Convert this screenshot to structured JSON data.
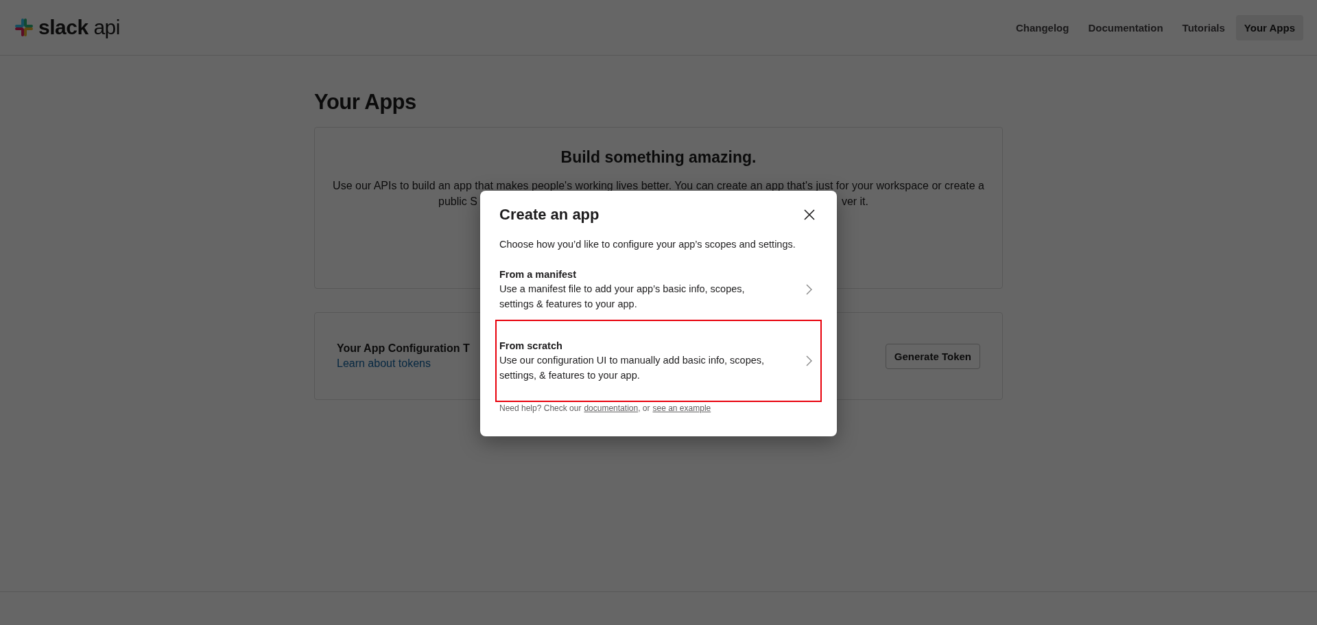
{
  "header": {
    "logo_text": "**slack** api",
    "nav": [
      {
        "label": "Changelog",
        "selected": false
      },
      {
        "label": "Documentation",
        "selected": false
      },
      {
        "label": "Tutorials",
        "selected": false
      },
      {
        "label": "Your Apps",
        "selected": true
      }
    ]
  },
  "page_title": "Your Apps",
  "intro_card": {
    "heading": "Build something amazing.",
    "line_1": "Use our APIs to build an app that makes people's working lives better. You can create an app that's just for your workspace or create a",
    "line_2_start": "public S",
    "line_2_end": "ver it."
  },
  "token_card": {
    "title": "Your App Configuration T",
    "link": "Learn about tokens",
    "button": "Generate Token"
  },
  "modal": {
    "title": "Create an app",
    "description": "Choose how you’d like to configure your app’s scopes and settings.",
    "options": [
      {
        "title": "From a manifest",
        "description": "Use a manifest file to add your app’s basic info, scopes, settings & features to your app.",
        "highlighted": false
      },
      {
        "title": "From scratch",
        "description": "Use our configuration UI to manually add basic info, scopes, settings, & features to your app.",
        "highlighted": true
      }
    ],
    "help_text": "Need help? Check our",
    "help_link_1": "documentation",
    "help_separator": ", or",
    "help_link_2": "see an example"
  }
}
